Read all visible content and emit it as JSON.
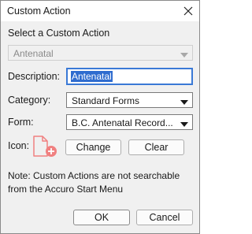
{
  "window": {
    "title": "Custom Action"
  },
  "custom_action": {
    "section_label": "Select a Custom Action",
    "selected": "Antenatal"
  },
  "fields": {
    "description_label": "Description:",
    "description_value": "Antenatal",
    "category_label": "Category:",
    "category_value": "Standard Forms",
    "form_label": "Form:",
    "form_value": "B.C. Antenatal Record...",
    "icon_label": "Icon:"
  },
  "buttons": {
    "change": "Change",
    "clear": "Clear",
    "ok": "OK",
    "cancel": "Cancel"
  },
  "note": "Note: Custom Actions are not searchable from the Accuro Start Menu",
  "icons": {
    "close": "close-icon",
    "file_add": "file-add-icon",
    "dropdown": "chevron-down-icon"
  },
  "colors": {
    "accent": "#3a79d6",
    "selection": "#2f6ccf",
    "file_icon": "#f08080"
  }
}
